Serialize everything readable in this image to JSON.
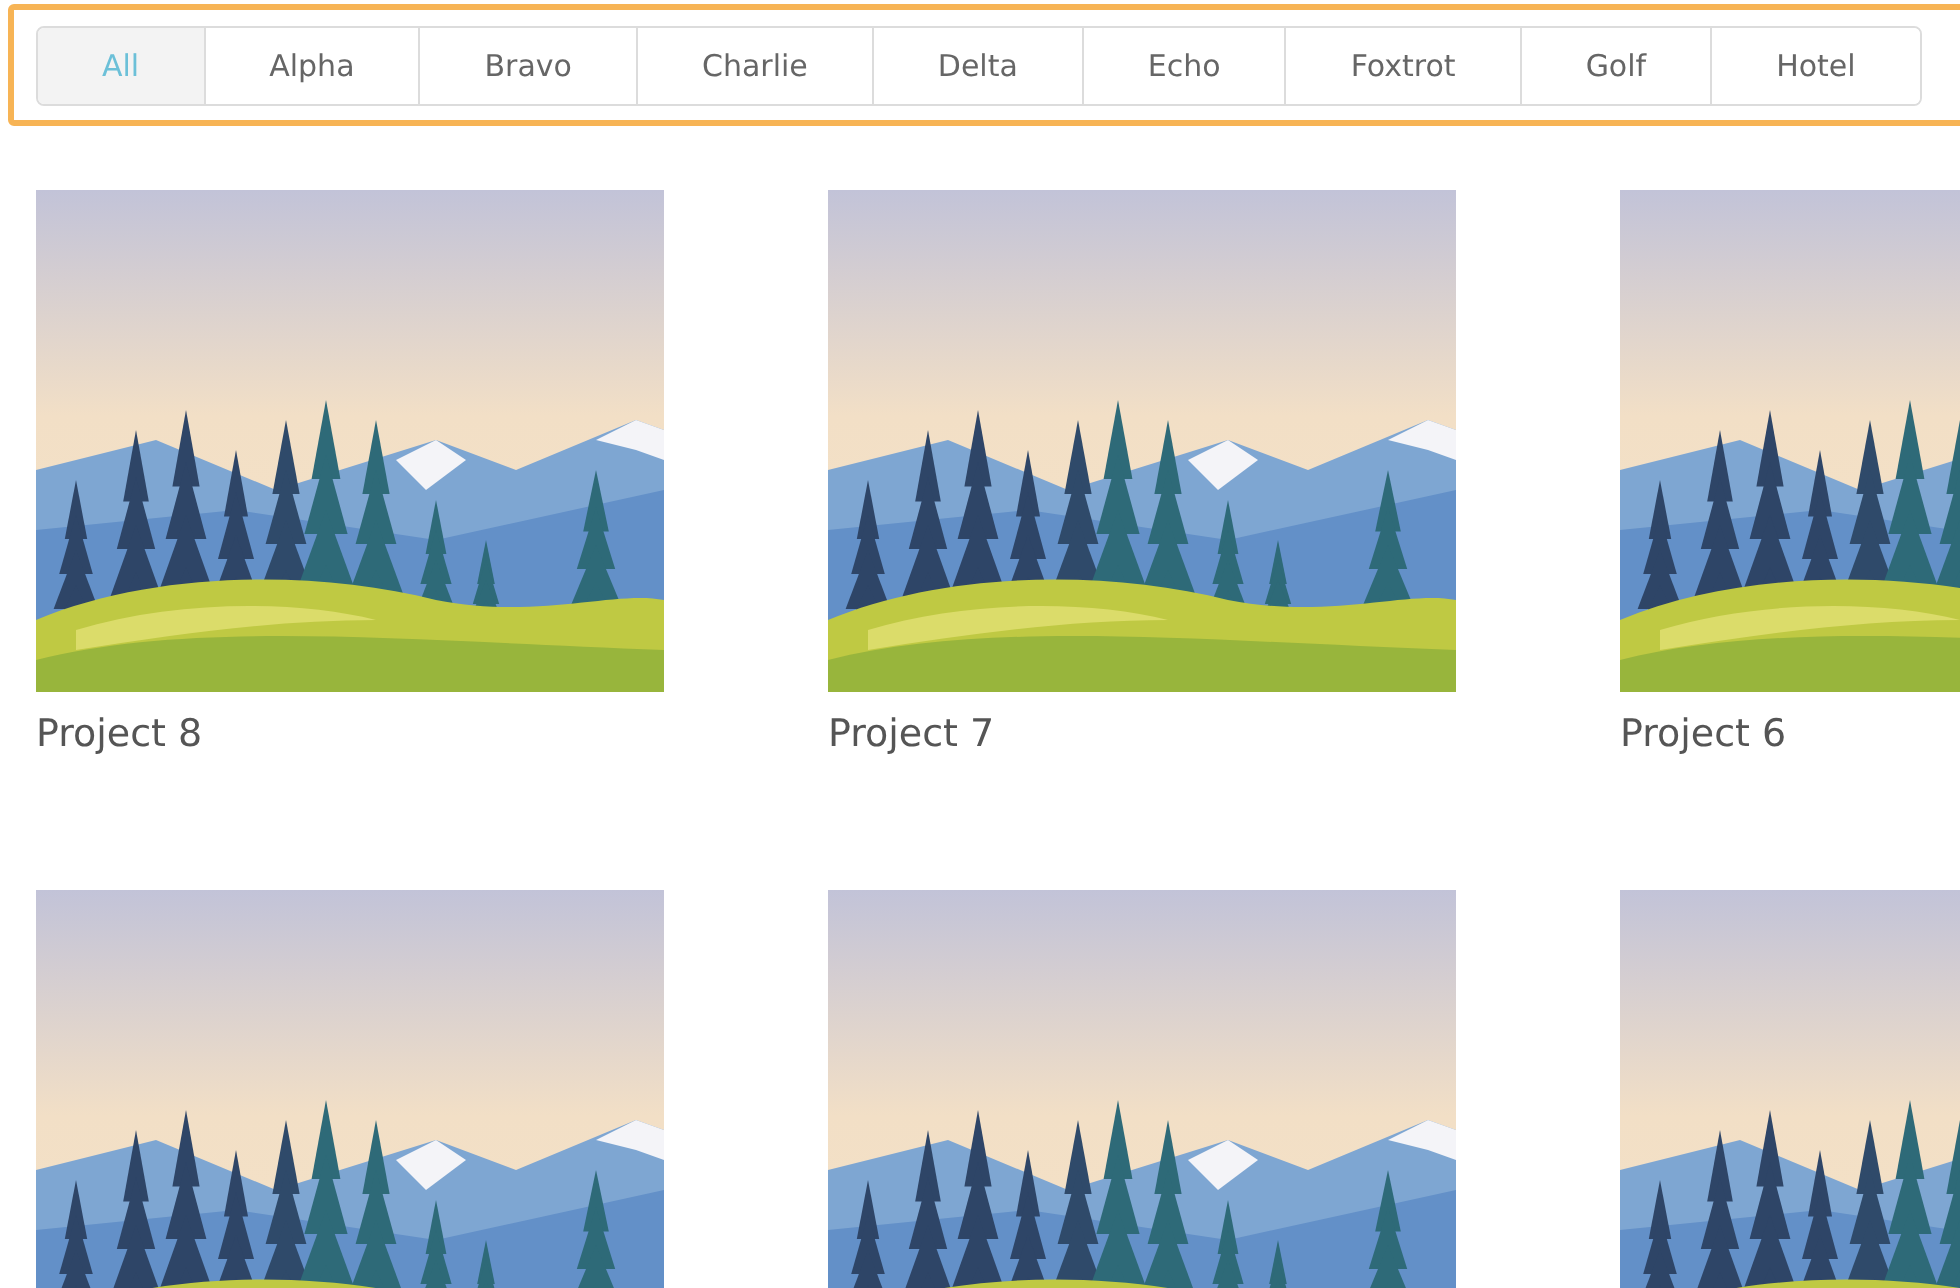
{
  "filter_tabs": [
    {
      "label": "All",
      "selected": true
    },
    {
      "label": "Alpha",
      "selected": false
    },
    {
      "label": "Bravo",
      "selected": false
    },
    {
      "label": "Charlie",
      "selected": false
    },
    {
      "label": "Delta",
      "selected": false
    },
    {
      "label": "Echo",
      "selected": false
    },
    {
      "label": "Foxtrot",
      "selected": false
    },
    {
      "label": "Golf",
      "selected": false
    },
    {
      "label": "Hotel",
      "selected": false
    }
  ],
  "projects": [
    {
      "kind": "captioned",
      "title": "Project 8"
    },
    {
      "kind": "captioned",
      "title": "Project 7"
    },
    {
      "kind": "captioned",
      "title": "Project 6"
    },
    {
      "kind": "image_only"
    },
    {
      "kind": "image_only"
    },
    {
      "kind": "image_only"
    }
  ]
}
